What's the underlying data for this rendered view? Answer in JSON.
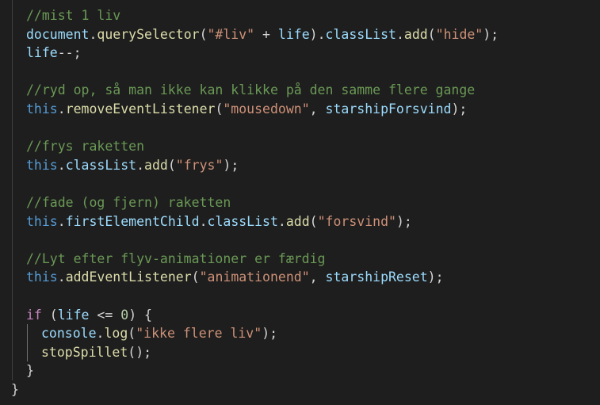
{
  "lines": [
    {
      "tokens": [
        {
          "t": "//mist 1 liv",
          "k": "comment"
        }
      ]
    },
    {
      "tokens": [
        {
          "t": "document",
          "k": "var"
        },
        {
          "t": ".",
          "k": "plain"
        },
        {
          "t": "querySelector",
          "k": "func"
        },
        {
          "t": "(",
          "k": "plain"
        },
        {
          "t": "\"#liv\"",
          "k": "str"
        },
        {
          "t": " + ",
          "k": "plain"
        },
        {
          "t": "life",
          "k": "var"
        },
        {
          "t": ").",
          "k": "plain"
        },
        {
          "t": "classList",
          "k": "var"
        },
        {
          "t": ".",
          "k": "plain"
        },
        {
          "t": "add",
          "k": "func"
        },
        {
          "t": "(",
          "k": "plain"
        },
        {
          "t": "\"hide\"",
          "k": "str"
        },
        {
          "t": ");",
          "k": "plain"
        }
      ]
    },
    {
      "tokens": [
        {
          "t": "life",
          "k": "var"
        },
        {
          "t": "--;",
          "k": "plain"
        }
      ]
    },
    {
      "tokens": []
    },
    {
      "tokens": [
        {
          "t": "//ryd op, så man ikke kan klikke på den samme flere gange",
          "k": "comment"
        }
      ]
    },
    {
      "tokens": [
        {
          "t": "this",
          "k": "kw"
        },
        {
          "t": ".",
          "k": "plain"
        },
        {
          "t": "removeEventListener",
          "k": "func"
        },
        {
          "t": "(",
          "k": "plain"
        },
        {
          "t": "\"mousedown\"",
          "k": "str"
        },
        {
          "t": ", ",
          "k": "plain"
        },
        {
          "t": "starshipForsvind",
          "k": "var"
        },
        {
          "t": ");",
          "k": "plain"
        }
      ]
    },
    {
      "tokens": []
    },
    {
      "tokens": [
        {
          "t": "//frys raketten",
          "k": "comment"
        }
      ]
    },
    {
      "tokens": [
        {
          "t": "this",
          "k": "kw"
        },
        {
          "t": ".",
          "k": "plain"
        },
        {
          "t": "classList",
          "k": "var"
        },
        {
          "t": ".",
          "k": "plain"
        },
        {
          "t": "add",
          "k": "func"
        },
        {
          "t": "(",
          "k": "plain"
        },
        {
          "t": "\"frys\"",
          "k": "str"
        },
        {
          "t": ");",
          "k": "plain"
        }
      ]
    },
    {
      "tokens": []
    },
    {
      "tokens": [
        {
          "t": "//fade (og fjern) raketten",
          "k": "comment"
        }
      ]
    },
    {
      "tokens": [
        {
          "t": "this",
          "k": "kw"
        },
        {
          "t": ".",
          "k": "plain"
        },
        {
          "t": "firstElementChild",
          "k": "var"
        },
        {
          "t": ".",
          "k": "plain"
        },
        {
          "t": "classList",
          "k": "var"
        },
        {
          "t": ".",
          "k": "plain"
        },
        {
          "t": "add",
          "k": "func"
        },
        {
          "t": "(",
          "k": "plain"
        },
        {
          "t": "\"forsvind\"",
          "k": "str"
        },
        {
          "t": ");",
          "k": "plain"
        }
      ]
    },
    {
      "tokens": []
    },
    {
      "tokens": [
        {
          "t": "//Lyt efter flyv-animationer er færdig",
          "k": "comment"
        }
      ]
    },
    {
      "tokens": [
        {
          "t": "this",
          "k": "kw"
        },
        {
          "t": ".",
          "k": "plain"
        },
        {
          "t": "addEventListener",
          "k": "func"
        },
        {
          "t": "(",
          "k": "plain"
        },
        {
          "t": "\"animationend\"",
          "k": "str"
        },
        {
          "t": ", ",
          "k": "plain"
        },
        {
          "t": "starshipReset",
          "k": "var"
        },
        {
          "t": ");",
          "k": "plain"
        }
      ]
    },
    {
      "tokens": []
    },
    {
      "tokens": [
        {
          "t": "if",
          "k": "ctrl"
        },
        {
          "t": " (",
          "k": "plain"
        },
        {
          "t": "life",
          "k": "var"
        },
        {
          "t": " <= ",
          "k": "plain"
        },
        {
          "t": "0",
          "k": "num"
        },
        {
          "t": ") {",
          "k": "plain"
        }
      ]
    },
    {
      "tokens": [
        {
          "t": "console",
          "k": "var"
        },
        {
          "t": ".",
          "k": "plain"
        },
        {
          "t": "log",
          "k": "func"
        },
        {
          "t": "(",
          "k": "plain"
        },
        {
          "t": "\"ikke flere liv\"",
          "k": "str"
        },
        {
          "t": ");",
          "k": "plain"
        }
      ]
    },
    {
      "tokens": [
        {
          "t": "stopSpillet",
          "k": "func"
        },
        {
          "t": "();",
          "k": "plain"
        }
      ]
    },
    {
      "tokens": [
        {
          "t": "}",
          "k": "plain"
        }
      ]
    },
    {
      "tokens": [
        {
          "t": "}",
          "k": "plain"
        }
      ]
    }
  ]
}
